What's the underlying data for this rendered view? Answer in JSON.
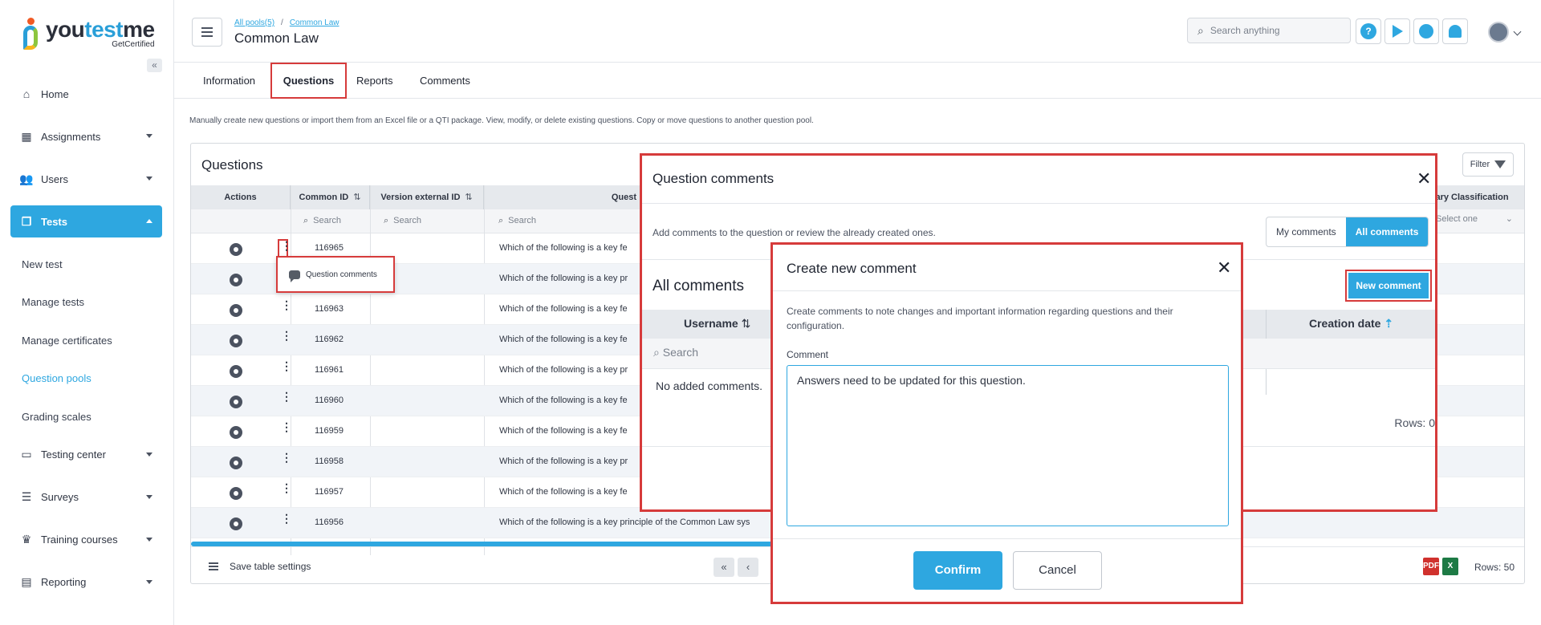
{
  "brand": {
    "name_a": "you",
    "name_b": "test",
    "name_c": "me",
    "tagline": "GetCertified"
  },
  "sidebar": {
    "items": [
      {
        "label": "Home",
        "icon": "home-icon"
      },
      {
        "label": "Assignments",
        "icon": "grid-icon"
      },
      {
        "label": "Users",
        "icon": "users-icon"
      },
      {
        "label": "Tests",
        "icon": "tests-icon",
        "active": true
      }
    ],
    "sub_items": [
      "New test",
      "Manage tests",
      "Manage certificates",
      "Question pools",
      "Grading scales"
    ],
    "current_sub": "Question pools",
    "items_after": [
      {
        "label": "Testing center",
        "icon": "monitor-icon"
      },
      {
        "label": "Surveys",
        "icon": "survey-icon"
      },
      {
        "label": "Training courses",
        "icon": "trophy-icon"
      },
      {
        "label": "Reporting",
        "icon": "report-icon"
      }
    ]
  },
  "header": {
    "breadcrumb_1": "All pools(5)",
    "breadcrumb_2": "Common Law",
    "title": "Common Law",
    "search_placeholder": "Search anything",
    "help_glyph": "?"
  },
  "tabs": [
    "Information",
    "Questions",
    "Reports",
    "Comments"
  ],
  "selected_tab": "Questions",
  "description": "Manually create new questions or import them from an Excel file or a QTI package. View, modify, or delete existing questions. Copy or move questions to another question pool.",
  "questions": {
    "title": "Questions",
    "filter_label": "Filter",
    "columns": [
      "Actions",
      "Common ID",
      "Version external ID",
      "Quest",
      "ary Classification"
    ],
    "search_label": "Search",
    "select_one": "Select one",
    "rows": [
      {
        "id": "116965",
        "text": "Which of the following is a key fe"
      },
      {
        "id": "",
        "text": "Which of the following is a key pr"
      },
      {
        "id": "116963",
        "text": "Which of the following is a key fe"
      },
      {
        "id": "116962",
        "text": "Which of the following is a key fe"
      },
      {
        "id": "116961",
        "text": "Which of the following is a key pr"
      },
      {
        "id": "116960",
        "text": "Which of the following is a key fe"
      },
      {
        "id": "116959",
        "text": "Which of the following is a key fe"
      },
      {
        "id": "116958",
        "text": "Which of the following is a key pr"
      },
      {
        "id": "116957",
        "text": "Which of the following is a key fe"
      },
      {
        "id": "116956",
        "text": "Which of the following is a key principle of the Common Law sys"
      }
    ],
    "save_settings": "Save table settings",
    "rows_count": "Rows: 50",
    "pdf_label": "PDF",
    "xls_label": "X",
    "first_page_glyph": "«",
    "prev_page_glyph": "‹"
  },
  "popover": {
    "label": "Question comments"
  },
  "question_comments": {
    "title": "Question comments",
    "description": "Add comments to the question or review the already created ones.",
    "my_comments": "My comments",
    "all_comments_btn": "All comments",
    "subtitle": "All comments",
    "new_comment": "New comment",
    "col_username": "Username",
    "col_creation": "Creation date",
    "search_label": "Search",
    "empty": "No added comments.",
    "rows": "Rows: 0"
  },
  "new_comment": {
    "title": "Create new comment",
    "description": "Create comments to note changes and important information regarding questions and their configuration.",
    "label": "Comment",
    "value": "Answers need to be updated for this question.",
    "confirm": "Confirm",
    "cancel": "Cancel"
  },
  "colors": {
    "accent": "#2ea7e0",
    "highlight": "#d63b3b",
    "excel": "#1d7a45",
    "pdf": "#d0312d"
  }
}
